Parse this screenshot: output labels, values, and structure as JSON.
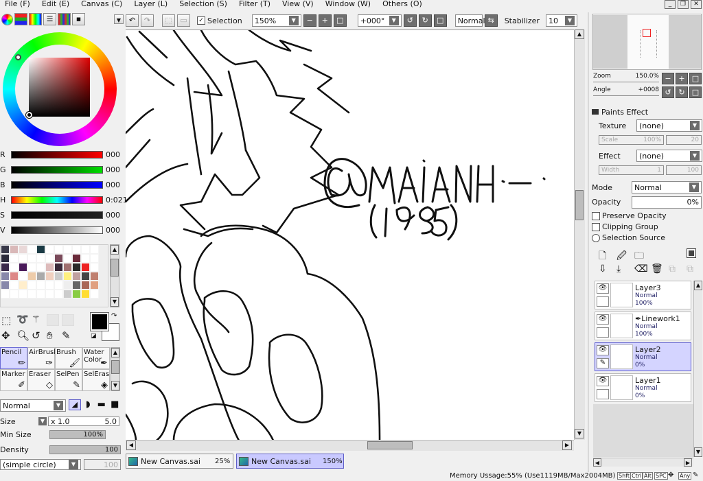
{
  "menu": [
    "File (F)",
    "Edit (E)",
    "Canvas (C)",
    "Layer (L)",
    "Selection (S)",
    "Filter (T)",
    "View (V)",
    "Window (W)",
    "Others (O)"
  ],
  "toolbar": {
    "selection_label": "Selection",
    "zoom_value": "150%",
    "rotation_value": "+000°",
    "blend_mode": "Normal",
    "stabilizer_label": "Stabilizer",
    "stabilizer_value": "10"
  },
  "color": {
    "r_label": "R",
    "r_value": "000",
    "g_label": "G",
    "g_value": "000",
    "b_label": "B",
    "b_value": "000",
    "h_label": "H",
    "h_value": "0:021",
    "s_label": "S",
    "s_value": "000",
    "v_label": "V",
    "v_value": "000",
    "foreground": "#000000",
    "background": "#ffffff",
    "palette": [
      "#3a3a4a",
      "#d9b8b8",
      "#e9d8d8",
      "#ffffff",
      "#1a3a44",
      "#ffffff",
      "#ffffff",
      "#ffffff",
      "#ffffff",
      "#ffffff",
      "#ffffff",
      "#2a2a3a",
      "#ffffff",
      "#ffffff",
      "#ffffff",
      "#ffffff",
      "#ffffff",
      "#7a4a5a",
      "#ffffff",
      "#6a2a3a",
      "#ffffff",
      "#ffffff",
      "#3a2a4a",
      "#ffffff",
      "#4a1a5a",
      "#ffffff",
      "#ffffff",
      "#ddbbbb",
      "#3a2a3a",
      "#a07070",
      "#2a2a2a",
      "#ee2222",
      "#ffffff",
      "#8888aa",
      "#dd8888",
      "#ffffff",
      "#eeccaa",
      "#aaaaaa",
      "#f0d0c0",
      "#cccccc",
      "#fff080",
      "#c0a0a0",
      "#444444",
      "#c08070",
      "#8888aa",
      "#ffffff",
      "#ffeecc",
      "#ffffff",
      "#ffffff",
      "#ffffff",
      "#ffffff",
      "#eeeeee",
      "#666666",
      "#aa6655",
      "#e0a080",
      "#ffffff",
      "#ffffff",
      "#ffffff",
      "#ffffff",
      "#ffffff",
      "#ffffff",
      "#ffffff",
      "#cccccc",
      "#88cc44",
      "#ffdd33",
      "#ffffff"
    ]
  },
  "tools": {
    "row1": [
      "Pencil",
      "AirBrush",
      "Brush",
      "Water Color"
    ],
    "row2": [
      "Marker",
      "Eraser",
      "SelPen",
      "SelEras"
    ]
  },
  "brush": {
    "mode": "Normal",
    "size_label": "Size",
    "size_mult": "x 1.0",
    "size_value": "5.0",
    "min_size_label": "Min Size",
    "min_size_value": "100%",
    "density_label": "Density",
    "density_value": "100",
    "shape": "(simple circle)",
    "shape_value": "100"
  },
  "navigator": {
    "zoom_label": "Zoom",
    "zoom_value": "150.0%",
    "angle_label": "Angle",
    "angle_value": "+0008"
  },
  "paints_effect": {
    "title": "Paints Effect",
    "texture_label": "Texture",
    "texture_value": "(none)",
    "scale_label": "Scale",
    "scale_value": "100%",
    "scale_num": "20",
    "effect_label": "Effect",
    "effect_value": "(none)",
    "width_label": "Width",
    "width_value": "1",
    "width_num": "100"
  },
  "layer_props": {
    "mode_label": "Mode",
    "mode_value": "Normal",
    "opacity_label": "Opacity",
    "opacity_value": "0%",
    "preserve_opacity": "Preserve Opacity",
    "clipping_group": "Clipping Group",
    "selection_source": "Selection Source"
  },
  "layers": [
    {
      "name": "Layer3",
      "mode": "Normal",
      "opacity": "100%"
    },
    {
      "name": "Linework1",
      "mode": "Normal",
      "opacity": "100%"
    },
    {
      "name": "Layer2",
      "mode": "Normal",
      "opacity": "0%"
    },
    {
      "name": "Layer1",
      "mode": "Normal",
      "opacity": "0%"
    }
  ],
  "tabs": [
    {
      "name": "New Canvas.sai",
      "zoom": "25%"
    },
    {
      "name": "New Canvas.sai",
      "zoom": "150%"
    }
  ],
  "status": {
    "memory": "Memory Ussage:55% (Use1119MB/Max2004MB)",
    "keys": [
      "Shft",
      "Ctrl",
      "Alt",
      "SPC",
      "Any"
    ]
  }
}
